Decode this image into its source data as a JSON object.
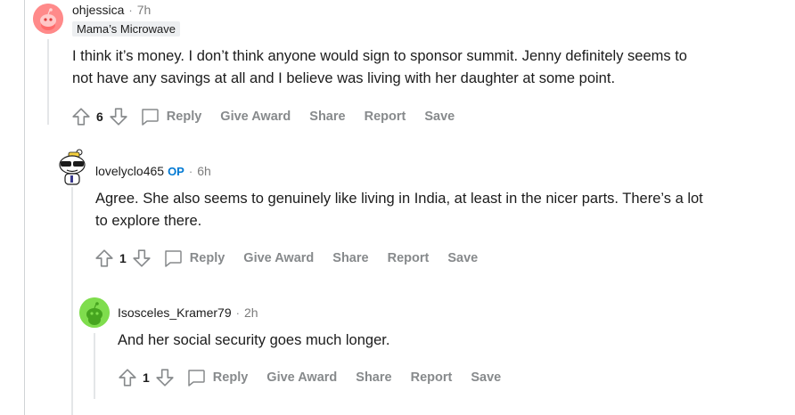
{
  "comments": [
    {
      "author": "ohjessica",
      "time": "7h",
      "flair": "Mama’s Microwave",
      "body_line1": "I think it’s money. I don’t think anyone would sign to sponsor summit. Jenny definitely seems to",
      "body_line2": "not have any savings at all and I believe was living with her daughter at some point.",
      "votes": "6"
    },
    {
      "author": "lovelyclo465",
      "op_badge": "OP",
      "time": "6h",
      "body_line1": "Agree. She also seems to genuinely like living in India, at least in the nicer parts. There’s a lot",
      "body_line2": "to explore there.",
      "votes": "1"
    },
    {
      "author": "Isosceles_Kramer79",
      "time": "2h",
      "body_line1": "And her social security goes much longer.",
      "votes": "1"
    }
  ],
  "actions": {
    "reply": "Reply",
    "give_award": "Give Award",
    "share": "Share",
    "report": "Report",
    "save": "Save"
  },
  "separator": "·",
  "colors": {
    "avatar1": "#ff8a8a",
    "avatar3": "#7fdd4d",
    "op": "#0079d3",
    "meta": "#878a8c"
  },
  "icons": [
    "upvote-icon",
    "downvote-icon",
    "comment-bubble-icon",
    "reddit-snoo-icon"
  ]
}
